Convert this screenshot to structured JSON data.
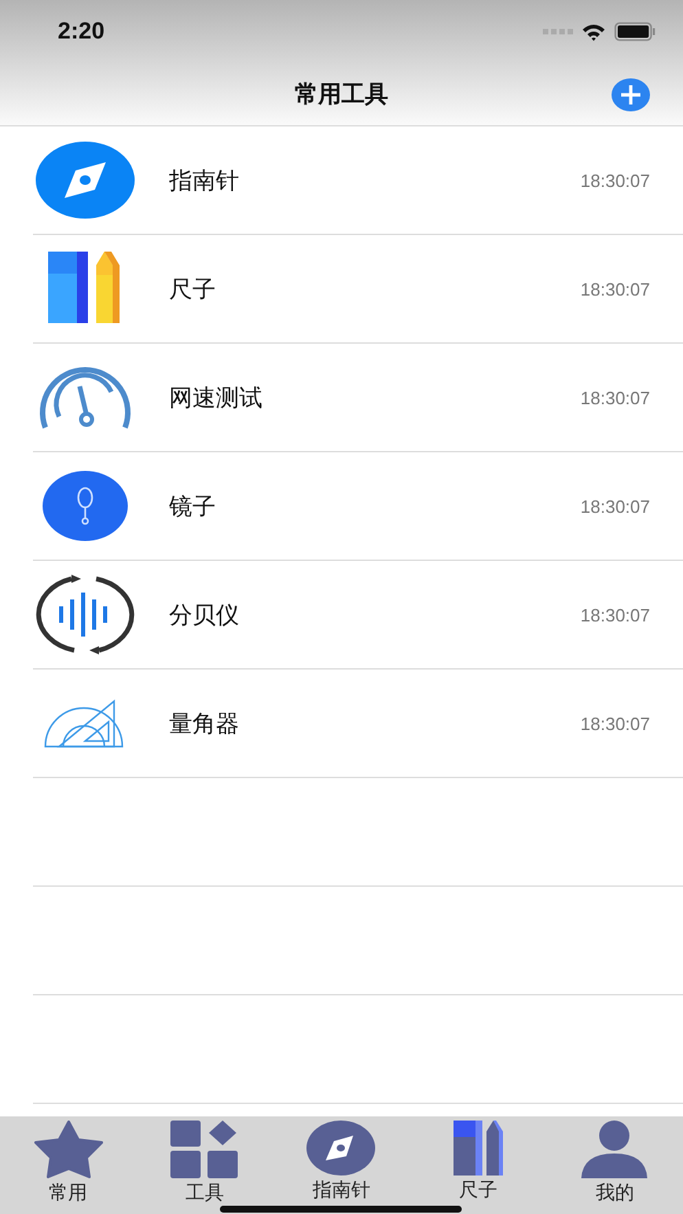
{
  "status_bar": {
    "time": "2:20"
  },
  "nav_bar": {
    "title": "常用工具"
  },
  "tools": [
    {
      "kind": "compass",
      "name": "指南针",
      "time": "18:30:07"
    },
    {
      "kind": "ruler",
      "name": "尺子",
      "time": "18:30:07"
    },
    {
      "kind": "speed",
      "name": "网速测试",
      "time": "18:30:07"
    },
    {
      "kind": "mirror",
      "name": "镜子",
      "time": "18:30:07"
    },
    {
      "kind": "decibel",
      "name": "分贝仪",
      "time": "18:30:07"
    },
    {
      "kind": "protractor",
      "name": "量角器",
      "time": "18:30:07"
    }
  ],
  "tab_bar": [
    {
      "kind": "star",
      "label": "常用"
    },
    {
      "kind": "grid",
      "label": "工具"
    },
    {
      "kind": "compass",
      "label": "指南针"
    },
    {
      "kind": "ruler",
      "label": "尺子"
    },
    {
      "kind": "person",
      "label": "我的"
    }
  ]
}
